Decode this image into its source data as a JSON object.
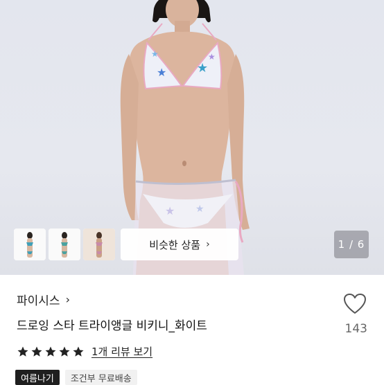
{
  "gallery": {
    "counter": "1 / 6",
    "similar_label": "비슷한 상품",
    "similar_chevron": "›",
    "thumbnails": [
      {
        "name": "thumbnail-1"
      },
      {
        "name": "thumbnail-2"
      },
      {
        "name": "thumbnail-3"
      }
    ]
  },
  "product": {
    "brand": "파이시스",
    "brand_chevron": "›",
    "title": "드로잉 스타 트라이앵글 비키니_화이트",
    "like_count": "143",
    "rating_stars": 5,
    "review_link": "1개 리뷰 보기"
  },
  "tags": [
    {
      "label": "여름나기",
      "style": "dark"
    },
    {
      "label": "조건부 무료배송",
      "style": "light"
    }
  ],
  "colors": {
    "star": "#222222",
    "tag_dark_bg": "#1f1f1f",
    "tag_light_bg": "#f1f1f1"
  }
}
